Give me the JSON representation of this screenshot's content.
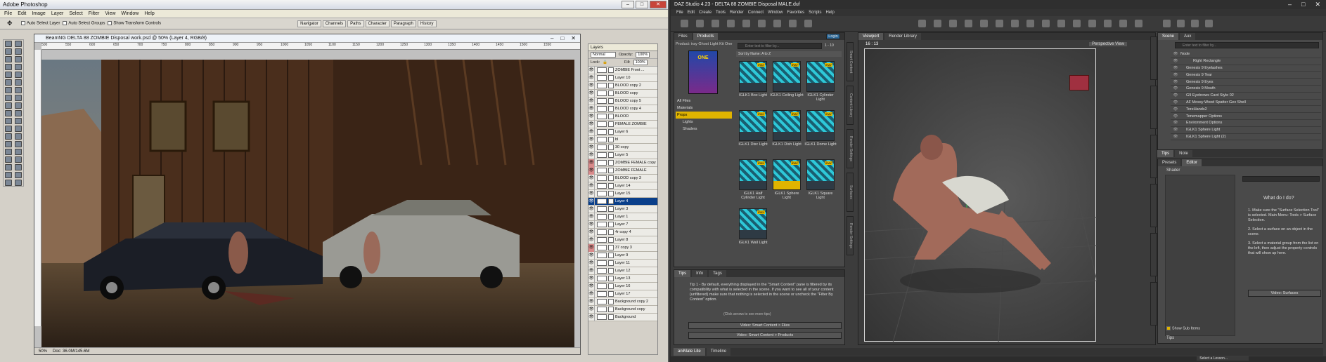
{
  "photoshop": {
    "app_title": "Adobe Photoshop",
    "menu": [
      "File",
      "Edit",
      "Image",
      "Layer",
      "Select",
      "Filter",
      "View",
      "Window",
      "Help"
    ],
    "options": {
      "auto_select_layer": "Auto Select Layer",
      "auto_select_groups": "Auto Select Groups",
      "show_transform": "Show Transform Controls"
    },
    "palette_tabs": [
      "Navigator",
      "Channels",
      "Paths",
      "Character",
      "Paragraph",
      "History"
    ],
    "document_title": "BeamNG DELTA 88 ZOMBIE Disposal work.psd @ 50% (Layer 4, RGB/8)",
    "ruler_marks": [
      "500",
      "550",
      "600",
      "650",
      "700",
      "750",
      "800",
      "850",
      "900",
      "950",
      "1000",
      "1050",
      "1100",
      "1150",
      "1200",
      "1250",
      "1300",
      "1350",
      "1400",
      "1450",
      "1500",
      "1550"
    ],
    "status_zoom": "50%",
    "status_doc": "Doc: 36.0M/145.6M",
    "layers_panel": {
      "title": "Layers",
      "blend_mode": "Normal",
      "opacity_label": "Opacity:",
      "opacity_value": "100%",
      "lock_label": "Lock:",
      "fill_label": "Fill:",
      "fill_value": "100%",
      "rows": [
        {
          "name": "ZOMBIE Front ...",
          "sel": false,
          "red": false
        },
        {
          "name": "Layer 10",
          "sel": false,
          "red": false
        },
        {
          "name": "BLOOD copy 2",
          "sel": false,
          "red": false
        },
        {
          "name": "BLOOD copy",
          "sel": false,
          "red": false
        },
        {
          "name": "BLOOD copy 5",
          "sel": false,
          "red": false
        },
        {
          "name": "BLOOD copy 4",
          "sel": false,
          "red": false
        },
        {
          "name": "BLOOD",
          "sel": false,
          "red": false
        },
        {
          "name": "FEMALE ZOMBIE",
          "sel": false,
          "red": false
        },
        {
          "name": "Layer 6",
          "sel": false,
          "red": false
        },
        {
          "name": "bl",
          "sel": false,
          "red": false
        },
        {
          "name": "30 copy",
          "sel": false,
          "red": false
        },
        {
          "name": "Layer 5",
          "sel": false,
          "red": false
        },
        {
          "name": "ZOMBIE FEMALE copy",
          "sel": false,
          "red": true
        },
        {
          "name": "ZOMBIE FEMALE",
          "sel": false,
          "red": true
        },
        {
          "name": "BLOOD copy 3",
          "sel": false,
          "red": false
        },
        {
          "name": "Layer 14",
          "sel": false,
          "red": false
        },
        {
          "name": "Layer 15",
          "sel": false,
          "red": false
        },
        {
          "name": "Layer 4",
          "sel": true,
          "red": false
        },
        {
          "name": "Layer 3",
          "sel": false,
          "red": false
        },
        {
          "name": "Layer 1",
          "sel": false,
          "red": false
        },
        {
          "name": "Layer 7",
          "sel": false,
          "red": false
        },
        {
          "name": "4r copy 4",
          "sel": false,
          "red": false
        },
        {
          "name": "Layer 8",
          "sel": false,
          "red": false
        },
        {
          "name": "37 copy 3",
          "sel": false,
          "red": true
        },
        {
          "name": "Layer 9",
          "sel": false,
          "red": false
        },
        {
          "name": "Layer 11",
          "sel": false,
          "red": false
        },
        {
          "name": "Layer 12",
          "sel": false,
          "red": false
        },
        {
          "name": "Layer 13",
          "sel": false,
          "red": false
        },
        {
          "name": "Layer 16",
          "sel": false,
          "red": false
        },
        {
          "name": "Layer 17",
          "sel": false,
          "red": false
        },
        {
          "name": "Background copy 2",
          "sel": false,
          "red": false
        },
        {
          "name": "Background copy",
          "sel": false,
          "red": false
        },
        {
          "name": "Background",
          "sel": false,
          "red": false
        }
      ]
    }
  },
  "daz": {
    "app_title": "DAZ Studio 4.23 - DELTA 88 ZOMBIE Disposal MALE.duf",
    "menu": [
      "File",
      "Edit",
      "Create",
      "Tools",
      "Render",
      "Connect",
      "Window",
      "Favorites",
      "Scripts",
      "Help"
    ],
    "smart_content": {
      "tabs": [
        "Files",
        "Products"
      ],
      "login": "Login",
      "product_label": "Product:",
      "product_name": "iray Ghost Light Kit One",
      "product_art_text": "ONE",
      "filter_placeholder": "Enter text to filter by...",
      "count": "1 - 10",
      "sort": "Sort by Name: A to Z",
      "categories": [
        "All Files",
        "Materials",
        "Props",
        "Lights",
        "Shaders"
      ],
      "items": [
        "IGLK1 Box Light",
        "IGLK1 Ceiling Light",
        "IGLK1 Cylinder Light",
        "IGLK1 Disc Light",
        "IGLK1 Dish Light",
        "IGLK1 Dome Light",
        "IGLK1 Half Cylinder Light",
        "IGLK1 Sphere Light",
        "IGLK1 Square Light",
        "IGLK1 Wall Light"
      ],
      "badge": "IRAY",
      "side_tabs": [
        "Smart Content",
        "Content Library",
        "Render Settings",
        "Surfaces",
        "Render Settings"
      ]
    },
    "tips": {
      "tabs": [
        "Tips",
        "Info",
        "Tags"
      ],
      "tip_text": "Tip 1 - By default, everything displayed in the \"Smart Content\" pane is filtered by its compatibility with what is selected in the scene. If you want to see all of your content (unfiltered) make sure that nothing is selected in the scene or uncheck the \"Filter By Context\" option.",
      "more": "(Click arrows to see more tips)",
      "video1": "Video: Smart Content > Files",
      "video2": "Video: Smart Content > Products"
    },
    "viewport": {
      "tabs": [
        "Viewport",
        "Render Library"
      ],
      "ratio": "16 : 13",
      "view": "Perspective View"
    },
    "scene": {
      "tabs": [
        "Scene",
        "Aux"
      ],
      "filter_placeholder": "Enter text to filter by...",
      "items": [
        "Node",
        "Right Rectangle",
        "Genesis 9 Eyelashes",
        "Genesis 9 Tear",
        "Genesis 9 Eyes",
        "Genesis 9 Mouth",
        "G9 Eyebrows Card Style 02",
        "AF Mossy Wood Spatter Gex Shell",
        "ToreHands2",
        "Tonemapper Options",
        "Environment Options",
        "IGLK1 Sphere Light",
        "IGLK1 Sphere Light (2)"
      ]
    },
    "surfaces": {
      "tabs": [
        "Tips",
        "Note"
      ],
      "sub_tabs": [
        "Presets",
        "Editor"
      ],
      "shader_label": "Shader",
      "help_title": "What do I do?",
      "steps": [
        "1. Make sure the \"Surface Selection Tool\" is selected. Main Menu: Tools > Surface Selection.",
        "2. Select a surface on an object in the scene.",
        "3. Select a material group from the list on the left, then adjust the property controls that will show up here."
      ],
      "video": "Video: Surfaces",
      "show_sub": "Show Sub Items",
      "footer_tab": "Tips"
    },
    "bottom_tabs": [
      "aniMate Lite",
      "Timeline"
    ],
    "lesson": "Select a Lesson..."
  }
}
